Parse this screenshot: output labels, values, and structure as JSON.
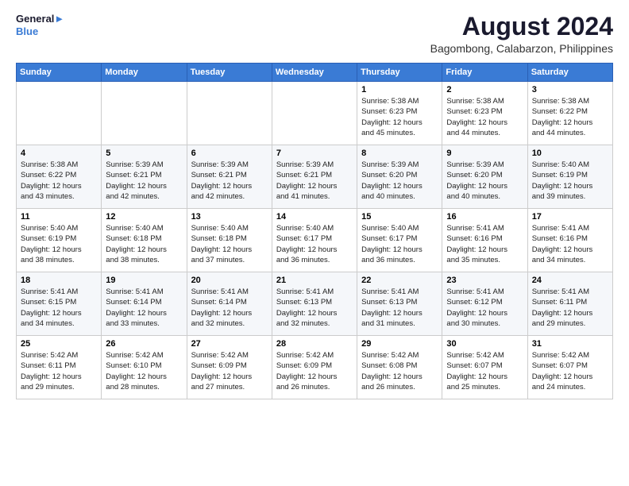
{
  "header": {
    "logo_line1": "General",
    "logo_line2": "Blue",
    "main_title": "August 2024",
    "subtitle": "Bagombong, Calabarzon, Philippines"
  },
  "weekdays": [
    "Sunday",
    "Monday",
    "Tuesday",
    "Wednesday",
    "Thursday",
    "Friday",
    "Saturday"
  ],
  "weeks": [
    [
      {
        "day": "",
        "info": ""
      },
      {
        "day": "",
        "info": ""
      },
      {
        "day": "",
        "info": ""
      },
      {
        "day": "",
        "info": ""
      },
      {
        "day": "1",
        "info": "Sunrise: 5:38 AM\nSunset: 6:23 PM\nDaylight: 12 hours\nand 45 minutes."
      },
      {
        "day": "2",
        "info": "Sunrise: 5:38 AM\nSunset: 6:23 PM\nDaylight: 12 hours\nand 44 minutes."
      },
      {
        "day": "3",
        "info": "Sunrise: 5:38 AM\nSunset: 6:22 PM\nDaylight: 12 hours\nand 44 minutes."
      }
    ],
    [
      {
        "day": "4",
        "info": "Sunrise: 5:38 AM\nSunset: 6:22 PM\nDaylight: 12 hours\nand 43 minutes."
      },
      {
        "day": "5",
        "info": "Sunrise: 5:39 AM\nSunset: 6:21 PM\nDaylight: 12 hours\nand 42 minutes."
      },
      {
        "day": "6",
        "info": "Sunrise: 5:39 AM\nSunset: 6:21 PM\nDaylight: 12 hours\nand 42 minutes."
      },
      {
        "day": "7",
        "info": "Sunrise: 5:39 AM\nSunset: 6:21 PM\nDaylight: 12 hours\nand 41 minutes."
      },
      {
        "day": "8",
        "info": "Sunrise: 5:39 AM\nSunset: 6:20 PM\nDaylight: 12 hours\nand 40 minutes."
      },
      {
        "day": "9",
        "info": "Sunrise: 5:39 AM\nSunset: 6:20 PM\nDaylight: 12 hours\nand 40 minutes."
      },
      {
        "day": "10",
        "info": "Sunrise: 5:40 AM\nSunset: 6:19 PM\nDaylight: 12 hours\nand 39 minutes."
      }
    ],
    [
      {
        "day": "11",
        "info": "Sunrise: 5:40 AM\nSunset: 6:19 PM\nDaylight: 12 hours\nand 38 minutes."
      },
      {
        "day": "12",
        "info": "Sunrise: 5:40 AM\nSunset: 6:18 PM\nDaylight: 12 hours\nand 38 minutes."
      },
      {
        "day": "13",
        "info": "Sunrise: 5:40 AM\nSunset: 6:18 PM\nDaylight: 12 hours\nand 37 minutes."
      },
      {
        "day": "14",
        "info": "Sunrise: 5:40 AM\nSunset: 6:17 PM\nDaylight: 12 hours\nand 36 minutes."
      },
      {
        "day": "15",
        "info": "Sunrise: 5:40 AM\nSunset: 6:17 PM\nDaylight: 12 hours\nand 36 minutes."
      },
      {
        "day": "16",
        "info": "Sunrise: 5:41 AM\nSunset: 6:16 PM\nDaylight: 12 hours\nand 35 minutes."
      },
      {
        "day": "17",
        "info": "Sunrise: 5:41 AM\nSunset: 6:16 PM\nDaylight: 12 hours\nand 34 minutes."
      }
    ],
    [
      {
        "day": "18",
        "info": "Sunrise: 5:41 AM\nSunset: 6:15 PM\nDaylight: 12 hours\nand 34 minutes."
      },
      {
        "day": "19",
        "info": "Sunrise: 5:41 AM\nSunset: 6:14 PM\nDaylight: 12 hours\nand 33 minutes."
      },
      {
        "day": "20",
        "info": "Sunrise: 5:41 AM\nSunset: 6:14 PM\nDaylight: 12 hours\nand 32 minutes."
      },
      {
        "day": "21",
        "info": "Sunrise: 5:41 AM\nSunset: 6:13 PM\nDaylight: 12 hours\nand 32 minutes."
      },
      {
        "day": "22",
        "info": "Sunrise: 5:41 AM\nSunset: 6:13 PM\nDaylight: 12 hours\nand 31 minutes."
      },
      {
        "day": "23",
        "info": "Sunrise: 5:41 AM\nSunset: 6:12 PM\nDaylight: 12 hours\nand 30 minutes."
      },
      {
        "day": "24",
        "info": "Sunrise: 5:41 AM\nSunset: 6:11 PM\nDaylight: 12 hours\nand 29 minutes."
      }
    ],
    [
      {
        "day": "25",
        "info": "Sunrise: 5:42 AM\nSunset: 6:11 PM\nDaylight: 12 hours\nand 29 minutes."
      },
      {
        "day": "26",
        "info": "Sunrise: 5:42 AM\nSunset: 6:10 PM\nDaylight: 12 hours\nand 28 minutes."
      },
      {
        "day": "27",
        "info": "Sunrise: 5:42 AM\nSunset: 6:09 PM\nDaylight: 12 hours\nand 27 minutes."
      },
      {
        "day": "28",
        "info": "Sunrise: 5:42 AM\nSunset: 6:09 PM\nDaylight: 12 hours\nand 26 minutes."
      },
      {
        "day": "29",
        "info": "Sunrise: 5:42 AM\nSunset: 6:08 PM\nDaylight: 12 hours\nand 26 minutes."
      },
      {
        "day": "30",
        "info": "Sunrise: 5:42 AM\nSunset: 6:07 PM\nDaylight: 12 hours\nand 25 minutes."
      },
      {
        "day": "31",
        "info": "Sunrise: 5:42 AM\nSunset: 6:07 PM\nDaylight: 12 hours\nand 24 minutes."
      }
    ]
  ]
}
